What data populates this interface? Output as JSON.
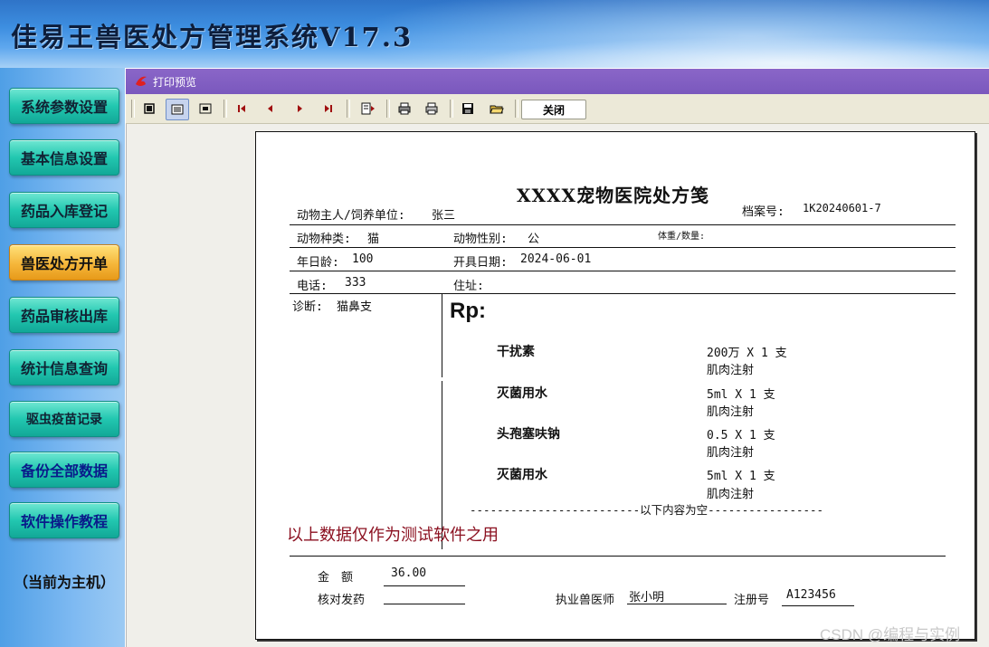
{
  "app": {
    "title": "佳易王兽医处方管理系统V17.3"
  },
  "sidebar": {
    "items": [
      {
        "label": "系统参数设置"
      },
      {
        "label": "基本信息设置"
      },
      {
        "label": "药品入库登记"
      },
      {
        "label": "兽医处方开单",
        "active": true
      },
      {
        "label": "药品审核出库"
      },
      {
        "label": "统计信息查询"
      },
      {
        "label": "驱虫疫苗记录"
      },
      {
        "label": "备份全部数据"
      },
      {
        "label": "软件操作教程"
      }
    ],
    "status": "（当前为主机）"
  },
  "preview": {
    "title": "打印预览",
    "toolbar": {
      "close_label": "关闭"
    }
  },
  "prescription": {
    "title": "XXXX宠物医院处方笺",
    "owner_label": "动物主人/饲养单位:",
    "owner": "张三",
    "record_label": "档案号:",
    "record_no": "1K20240601-7",
    "species_label": "动物种类:",
    "species": "猫",
    "sex_label": "动物性别:",
    "sex": "公",
    "weight_label": "体重/数量:",
    "age_label": "年日龄:",
    "age": "100",
    "date_label": "开具日期:",
    "date": "2024-06-01",
    "phone_label": "电话:",
    "phone": "333",
    "address_label": "住址:",
    "diagnosis_label": "诊断:",
    "diagnosis": "猫鼻支",
    "rp": "Rp:",
    "drugs": [
      {
        "name": "干扰素",
        "dose": "200万 X 1 支",
        "route": "肌肉注射"
      },
      {
        "name": "灭菌用水",
        "dose": "5ml X 1 支",
        "route": "肌肉注射"
      },
      {
        "name": "头孢塞呋钠",
        "dose": "0.5 X 1 支",
        "route": "肌肉注射"
      },
      {
        "name": "灭菌用水",
        "dose": "5ml X 1 支",
        "route": "肌肉注射"
      }
    ],
    "end_line": "-------------------------以下内容为空-----------------",
    "watermark_note": "以上数据仅作为测试软件之用",
    "amount_label": "金　额",
    "amount": "36.00",
    "check_label": "核对发药",
    "vet_label": "执业兽医师",
    "vet": "张小明",
    "reg_label": "注册号",
    "reg_no": "A123456"
  },
  "footer": {
    "credit": "CSDN @编程与实例"
  }
}
